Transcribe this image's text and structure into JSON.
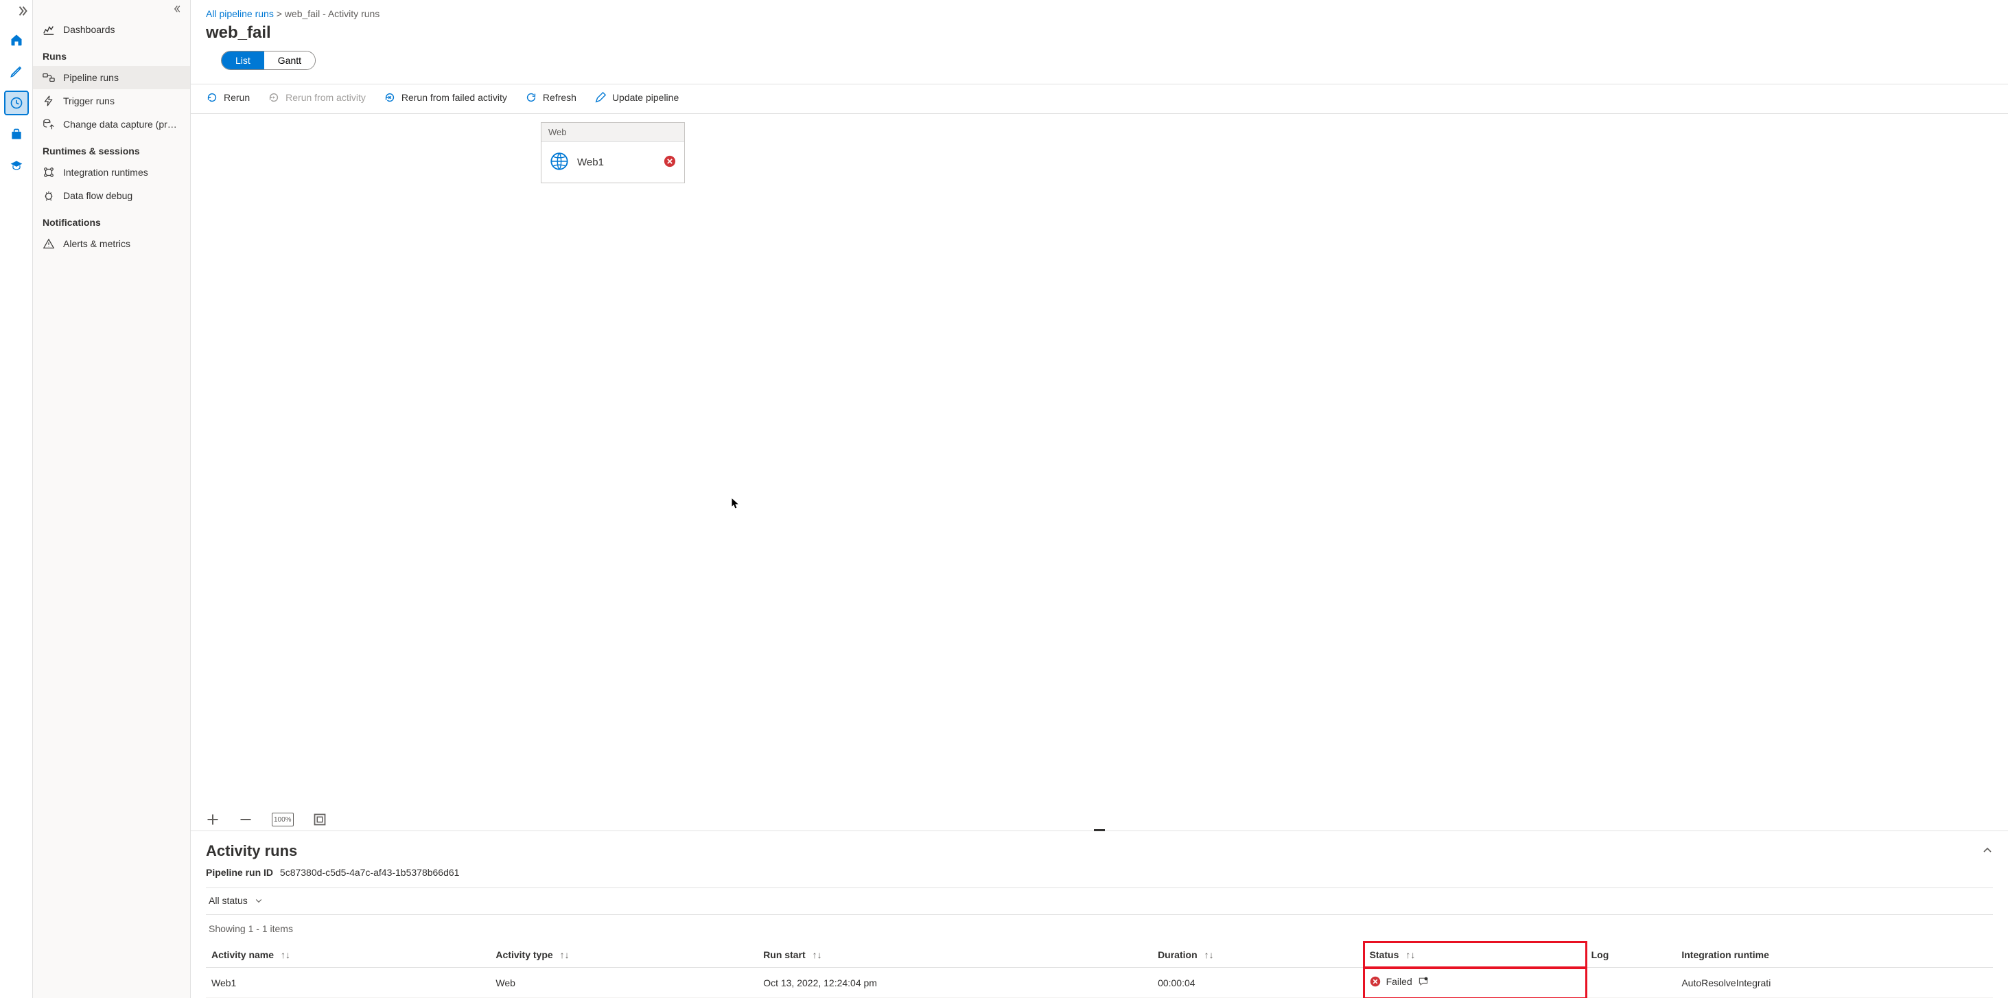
{
  "rail": {
    "items": [
      "home",
      "author",
      "monitor",
      "manage",
      "learn"
    ]
  },
  "sidebar": {
    "top": {
      "dashboards": "Dashboards"
    },
    "sections": {
      "runs": {
        "header": "Runs",
        "pipeline_runs": "Pipeline runs",
        "trigger_runs": "Trigger runs",
        "cdc": "Change data capture (previ..."
      },
      "runtimes": {
        "header": "Runtimes & sessions",
        "integration_runtimes": "Integration runtimes",
        "dataflow_debug": "Data flow debug"
      },
      "notifications": {
        "header": "Notifications",
        "alerts": "Alerts & metrics"
      }
    }
  },
  "breadcrumb": {
    "root": "All pipeline runs",
    "current": "web_fail - Activity runs"
  },
  "page_title": "web_fail",
  "view_toggle": {
    "list": "List",
    "gantt": "Gantt"
  },
  "toolbar": {
    "rerun": "Rerun",
    "rerun_from_activity": "Rerun from activity",
    "rerun_from_failed": "Rerun from failed activity",
    "refresh": "Refresh",
    "update_pipeline": "Update pipeline"
  },
  "activity_card": {
    "type": "Web",
    "name": "Web1"
  },
  "canvas_controls": {
    "zoom_label": "100%"
  },
  "runs_panel": {
    "title": "Activity runs",
    "run_id_label": "Pipeline run ID",
    "run_id": "5c87380d-c5d5-4a7c-af43-1b5378b66d61",
    "status_filter": "All status",
    "showing": "Showing 1 - 1 items",
    "columns": {
      "activity_name": "Activity name",
      "activity_type": "Activity type",
      "run_start": "Run start",
      "duration": "Duration",
      "status": "Status",
      "log": "Log",
      "integration_runtime": "Integration runtime"
    },
    "rows": [
      {
        "activity_name": "Web1",
        "activity_type": "Web",
        "run_start": "Oct 13, 2022, 12:24:04 pm",
        "duration": "00:00:04",
        "status": "Failed",
        "log": "",
        "integration_runtime": "AutoResolveIntegrati"
      }
    ]
  }
}
